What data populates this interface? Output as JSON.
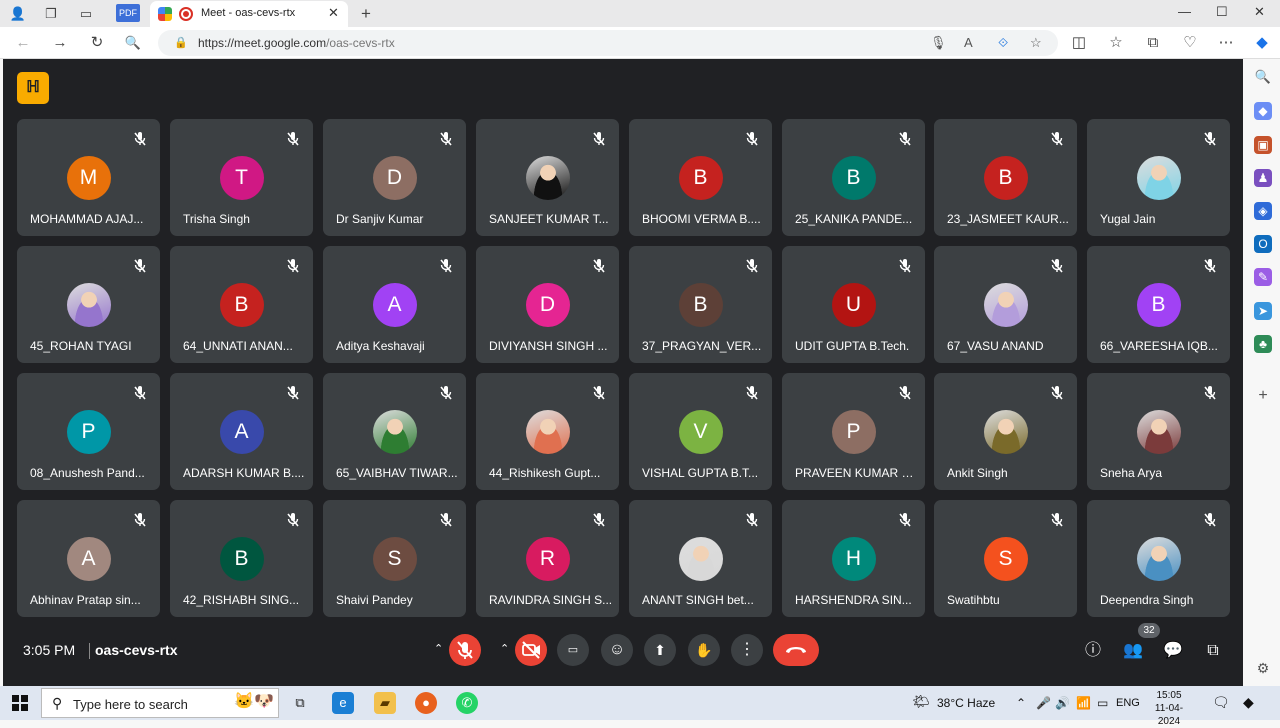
{
  "browser": {
    "tab_title": "Meet - oas-cevs-rtx",
    "pdf_label": "PDF",
    "url_host": "https://meet.google.com",
    "url_path": "/oas-cevs-rtx"
  },
  "meet": {
    "logo_text": "ℍ",
    "time": "3:05 PM",
    "meeting_code": "oas-cevs-rtx",
    "participant_count": "32"
  },
  "participants": [
    {
      "initial": "M",
      "name": "MOHAMMAD AJAJ...",
      "color": "#e8710a",
      "photo": false
    },
    {
      "initial": "T",
      "name": "Trisha Singh",
      "color": "#d01884",
      "photo": false
    },
    {
      "initial": "D",
      "name": "Dr Sanjiv Kumar",
      "color": "#8d6e63",
      "photo": false
    },
    {
      "initial": "",
      "name": "SANJEET KUMAR T...",
      "color": "#111111",
      "photo": true
    },
    {
      "initial": "B",
      "name": "BHOOMI VERMA B....",
      "color": "#c5221f",
      "photo": false
    },
    {
      "initial": "B",
      "name": "25_KANIKA PANDE...",
      "color": "#00796b",
      "photo": false
    },
    {
      "initial": "B",
      "name": "23_JASMEET KAUR...",
      "color": "#c5221f",
      "photo": false
    },
    {
      "initial": "",
      "name": "Yugal Jain",
      "color": "#7fd3e6",
      "photo": true
    },
    {
      "initial": "",
      "name": "45_ROHAN TYAGI",
      "color": "#9575cd",
      "photo": true
    },
    {
      "initial": "B",
      "name": "64_UNNATI ANAN...",
      "color": "#c5221f",
      "photo": false
    },
    {
      "initial": "A",
      "name": "Aditya Keshavaji",
      "color": "#a142f4",
      "photo": false
    },
    {
      "initial": "D",
      "name": "DIVIYANSH SINGH ...",
      "color": "#e52592",
      "photo": false
    },
    {
      "initial": "B",
      "name": "37_PRAGYAN_VER...",
      "color": "#5d4037",
      "photo": false
    },
    {
      "initial": "U",
      "name": "UDIT GUPTA B.Tech.",
      "color": "#b31412",
      "photo": false
    },
    {
      "initial": "",
      "name": "67_VASU ANAND",
      "color": "#b39ddb",
      "photo": true
    },
    {
      "initial": "B",
      "name": "66_VAREESHA IQB...",
      "color": "#a142f4",
      "photo": false
    },
    {
      "initial": "P",
      "name": "08_Anushesh Pand...",
      "color": "#0097a7",
      "photo": false
    },
    {
      "initial": "A",
      "name": "ADARSH KUMAR B....",
      "color": "#3949ab",
      "photo": false
    },
    {
      "initial": "",
      "name": "65_VAIBHAV TIWAR...",
      "color": "#2e7d32",
      "photo": true
    },
    {
      "initial": "",
      "name": "44_Rishikesh Gupt...",
      "color": "#e07050",
      "photo": true
    },
    {
      "initial": "V",
      "name": "VISHAL GUPTA B.T...",
      "color": "#7cb342",
      "photo": false
    },
    {
      "initial": "P",
      "name": "PRAVEEN KUMAR S...",
      "color": "#8d6e63",
      "photo": false
    },
    {
      "initial": "",
      "name": "Ankit Singh",
      "color": "#7a6a2a",
      "photo": true
    },
    {
      "initial": "",
      "name": "Sneha Arya",
      "color": "#7b3b3b",
      "photo": true
    },
    {
      "initial": "A",
      "name": "Abhinav Pratap sin...",
      "color": "#a1887f",
      "photo": false
    },
    {
      "initial": "B",
      "name": "42_RISHABH SING...",
      "color": "#00563f",
      "photo": false
    },
    {
      "initial": "S",
      "name": "Shaivi Pandey",
      "color": "#6d4c41",
      "photo": false
    },
    {
      "initial": "R",
      "name": "RAVINDRA SINGH S...",
      "color": "#d81b60",
      "photo": false
    },
    {
      "initial": "",
      "name": "ANANT SINGH bet...",
      "color": "#d8d8d8",
      "photo": true
    },
    {
      "initial": "H",
      "name": "HARSHENDRA SIN...",
      "color": "#00897b",
      "photo": false
    },
    {
      "initial": "S",
      "name": "Swatihbtu",
      "color": "#f4511e",
      "photo": false
    },
    {
      "initial": "",
      "name": "Deependra Singh",
      "color": "#4a90c2",
      "photo": true
    }
  ],
  "taskbar": {
    "search_placeholder": "Type here to search",
    "weather": "38°C  Haze",
    "lang": "ENG",
    "time": "15:05",
    "date": "11-04-2024"
  }
}
